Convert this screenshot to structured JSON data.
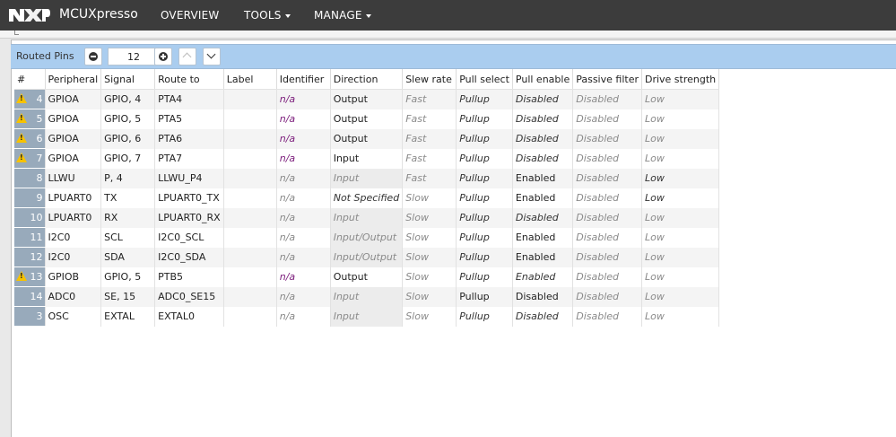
{
  "navbar": {
    "logo_text": "NXP",
    "brand": "MCUXpresso",
    "items": [
      {
        "label": "OVERVIEW",
        "dropdown": false
      },
      {
        "label": "TOOLS",
        "dropdown": true
      },
      {
        "label": "MANAGE",
        "dropdown": true
      }
    ]
  },
  "toolbar": {
    "title": "Routed Pins",
    "count_value": "12",
    "remove_icon": "minus-circle-icon",
    "add_icon": "plus-circle-icon",
    "up_icon": "chevron-up-icon",
    "down_icon": "chevron-down-icon"
  },
  "colors": {
    "navbar_bg": "#3c3c3c",
    "toolbar_bg": "#aacdef",
    "number_cell_bg": "#98aabb",
    "warning": "#f6c200",
    "identifier_na": "#7a1a7a"
  },
  "table": {
    "columns": [
      "#",
      "Peripheral",
      "Signal",
      "Route to",
      "Label",
      "Identifier",
      "Direction",
      "Slew rate",
      "Pull select",
      "Pull enable",
      "Passive filter",
      "Drive strength"
    ],
    "rows": [
      {
        "num": "4",
        "warning": true,
        "peripheral": "GPIOA",
        "signal": "GPIO, 4",
        "route": "PTA4",
        "label": "",
        "identifier": "n/a",
        "direction": "Output",
        "slew": "Fast",
        "pull_select": "Pullup",
        "pull_enable": "Disabled",
        "passive": "Disabled",
        "drive": "Low"
      },
      {
        "num": "5",
        "warning": true,
        "peripheral": "GPIOA",
        "signal": "GPIO, 5",
        "route": "PTA5",
        "label": "",
        "identifier": "n/a",
        "direction": "Output",
        "slew": "Fast",
        "pull_select": "Pullup",
        "pull_enable": "Disabled",
        "passive": "Disabled",
        "drive": "Low"
      },
      {
        "num": "6",
        "warning": true,
        "peripheral": "GPIOA",
        "signal": "GPIO, 6",
        "route": "PTA6",
        "label": "",
        "identifier": "n/a",
        "direction": "Output",
        "slew": "Fast",
        "pull_select": "Pullup",
        "pull_enable": "Disabled",
        "passive": "Disabled",
        "drive": "Low"
      },
      {
        "num": "7",
        "warning": true,
        "peripheral": "GPIOA",
        "signal": "GPIO, 7",
        "route": "PTA7",
        "label": "",
        "identifier": "n/a",
        "direction": "Input",
        "slew": "Fast",
        "pull_select": "Pullup",
        "pull_enable": "Disabled",
        "passive": "Disabled",
        "drive": "Low"
      },
      {
        "num": "8",
        "warning": false,
        "peripheral": "LLWU",
        "signal": "P, 4",
        "route": "LLWU_P4",
        "label": "",
        "identifier": "n/a",
        "direction": "Input",
        "slew": "Fast",
        "pull_select": "Pullup",
        "pull_enable": "Enabled",
        "passive": "Disabled",
        "drive": "Low"
      },
      {
        "num": "9",
        "warning": false,
        "peripheral": "LPUART0",
        "signal": "TX",
        "route": "LPUART0_TX",
        "label": "",
        "identifier": "n/a",
        "direction": "Not Specified",
        "slew": "Slow",
        "pull_select": "Pullup",
        "pull_enable": "Enabled",
        "passive": "Disabled",
        "drive": "Low"
      },
      {
        "num": "10",
        "warning": false,
        "peripheral": "LPUART0",
        "signal": "RX",
        "route": "LPUART0_RX",
        "label": "",
        "identifier": "n/a",
        "direction": "Input",
        "slew": "Slow",
        "pull_select": "Pullup",
        "pull_enable": "Disabled",
        "passive": "Disabled",
        "drive": "Low"
      },
      {
        "num": "11",
        "warning": false,
        "peripheral": "I2C0",
        "signal": "SCL",
        "route": "I2C0_SCL",
        "label": "",
        "identifier": "n/a",
        "direction": "Input/Output",
        "slew": "Slow",
        "pull_select": "Pullup",
        "pull_enable": "Enabled",
        "passive": "Disabled",
        "drive": "Low"
      },
      {
        "num": "12",
        "warning": false,
        "peripheral": "I2C0",
        "signal": "SDA",
        "route": "I2C0_SDA",
        "label": "",
        "identifier": "n/a",
        "direction": "Input/Output",
        "slew": "Slow",
        "pull_select": "Pullup",
        "pull_enable": "Enabled",
        "passive": "Disabled",
        "drive": "Low"
      },
      {
        "num": "13",
        "warning": true,
        "peripheral": "GPIOB",
        "signal": "GPIO, 5",
        "route": "PTB5",
        "label": "",
        "identifier": "n/a",
        "direction": "Output",
        "slew": "Slow",
        "pull_select": "Pullup",
        "pull_enable": "Enabled",
        "passive": "Disabled",
        "drive": "Low"
      },
      {
        "num": "14",
        "warning": false,
        "peripheral": "ADC0",
        "signal": "SE, 15",
        "route": "ADC0_SE15",
        "label": "",
        "identifier": "n/a",
        "direction": "Input",
        "slew": "Slow",
        "pull_select": "Pullup",
        "pull_enable": "Disabled",
        "passive": "Disabled",
        "drive": "Low"
      },
      {
        "num": "3",
        "warning": false,
        "peripheral": "OSC",
        "signal": "EXTAL",
        "route": "EXTAL0",
        "label": "",
        "identifier": "n/a",
        "direction": "Input",
        "slew": "Slow",
        "pull_select": "Pullup",
        "pull_enable": "Disabled",
        "passive": "Disabled",
        "drive": "Low"
      }
    ]
  }
}
